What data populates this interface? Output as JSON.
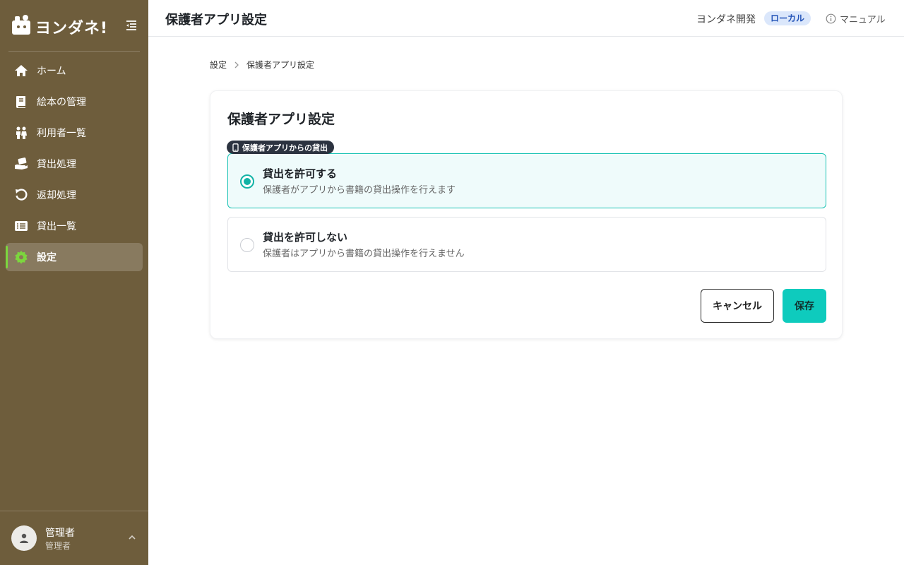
{
  "brand": {
    "logo_text": "ヨンダネ!"
  },
  "sidebar": {
    "items": [
      {
        "label": "ホーム",
        "icon": "home-icon"
      },
      {
        "label": "絵本の管理",
        "icon": "book-icon"
      },
      {
        "label": "利用者一覧",
        "icon": "users-icon"
      },
      {
        "label": "貸出処理",
        "icon": "lend-hand-icon"
      },
      {
        "label": "返却処理",
        "icon": "return-arrow-icon"
      },
      {
        "label": "貸出一覧",
        "icon": "list-icon"
      },
      {
        "label": "設定",
        "icon": "gear-icon",
        "active": true
      }
    ],
    "user": {
      "name": "管理者",
      "role": "管理者"
    }
  },
  "header": {
    "title": "保護者アプリ設定",
    "org_name": "ヨンダネ開発",
    "env_badge": "ローカル",
    "manual_label": "マニュアル"
  },
  "breadcrumb": {
    "parent": "設定",
    "current": "保護者アプリ設定"
  },
  "card": {
    "title": "保護者アプリ設定",
    "section_tag": "保護者アプリからの貸出",
    "options": [
      {
        "title": "貸出を許可する",
        "description": "保護者がアプリから書籍の貸出操作を行えます",
        "selected": true
      },
      {
        "title": "貸出を許可しない",
        "description": "保護者はアプリから書籍の貸出操作を行えません",
        "selected": false
      }
    ],
    "cancel_label": "キャンセル",
    "save_label": "保存"
  },
  "colors": {
    "sidebar_bg": "#6e5d3c",
    "accent": "#0ecbbd",
    "active_indicator": "#7cd63e",
    "badge_bg": "#dbe7fb"
  }
}
